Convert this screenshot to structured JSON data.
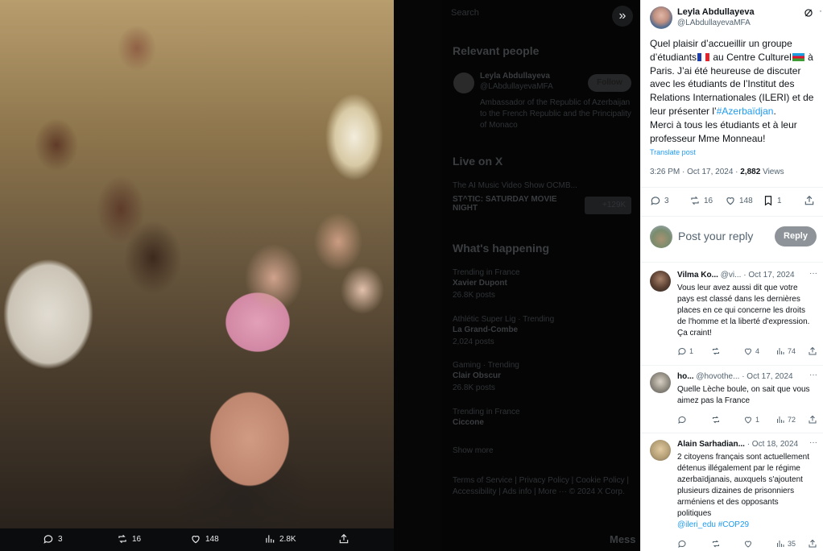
{
  "media": {
    "expand_icon": "chevrons-right-icon",
    "actions": {
      "replies": "3",
      "reposts": "16",
      "likes": "148",
      "views": "2.8K"
    }
  },
  "background": {
    "search_placeholder": "Search",
    "relevant_people_heading": "Relevant people",
    "person_name": "Leyla Abdullayeva",
    "person_handle": "@LAbdullayevaMFA",
    "follow_label": "Follow",
    "person_bio": "Ambassador of the Republic of Azerbaijan to the French Republic and the Principality of Monaco",
    "live_heading": "Live on X",
    "live_show": "The AI Music Video Show OCMB...",
    "live_title": "ST^TIC: SATURDAY MOVIE NIGHT",
    "live_count": "+129K",
    "happening_heading": "What's happening",
    "trends": [
      {
        "context": "Trending in France",
        "name": "Xavier Dupont",
        "posts": "26.8K posts"
      },
      {
        "context": "Athlétic Super Lig · Trending",
        "name": "La Grand-Combe",
        "posts": "2,024 posts"
      },
      {
        "context": "Gaming · Trending",
        "name": "Clair Obscur",
        "posts": "26.8K posts"
      },
      {
        "context": "Trending in France",
        "name": "Ciccone",
        "posts": ""
      }
    ],
    "show_more": "Show more",
    "footer_links": "Terms of Service | Privacy Policy | Cookie Policy | Accessibility | Ads info | More ··· © 2024 X Corp.",
    "messages_label": "Mess"
  },
  "tweet": {
    "author_name": "Leyla Abdullayeva",
    "author_handle": "@LAbdullayevaMFA",
    "text_part1": "Quel plaisir d’accueillir un groupe d’étudiants",
    "text_part2": " au Centre Culturel",
    "text_part3": " à Paris. J’ai été heureuse de discuter avec les étudiants de l’Institut des Relations Internationales (ILERI) et de leur présenter l’",
    "hashtag": "#Azerbaïdjan",
    "text_part4": ".",
    "text_part5": "Merci à tous les étudiants et à leur professeur Mme Monneau!",
    "translate_label": "Translate post",
    "time": "3:26 PM · Oct 17, 2024 · ",
    "views_count": "2,882",
    "views_label": " Views",
    "replies": "3",
    "reposts": "16",
    "likes": "148",
    "bookmarks": "1"
  },
  "reply_box": {
    "placeholder": "Post your reply",
    "button_label": "Reply"
  },
  "replies": [
    {
      "name": "Vilma Ko...",
      "handle": "@vi...",
      "date": "· Oct 17, 2024",
      "text": "Vous leur avez aussi dit que votre pays est classé dans les dernières places en ce qui concerne les droits de l'homme et la liberté d'expression. Ça craint!",
      "replies": "1",
      "reposts": "",
      "likes": "4",
      "views": "74"
    },
    {
      "name": "ho...",
      "handle": "@hovothe...",
      "date": "· Oct 17, 2024",
      "text": "Quelle Lèche boule, on sait que vous aimez pas la France",
      "replies": "",
      "reposts": "",
      "likes": "1",
      "views": "72"
    },
    {
      "name": "Alain Sarhadian...",
      "handle": "",
      "date": "· Oct 18, 2024",
      "text": "2 citoyens français sont actuellement détenus illégalement par le régime azerbaïdjanais, auxquels s'ajoutent plusieurs dizaines de prisonniers arméniens et des opposants politiques",
      "mentions": "@ileri_edu #COP29",
      "replies": "",
      "reposts": "",
      "likes": "",
      "views": "35"
    }
  ]
}
